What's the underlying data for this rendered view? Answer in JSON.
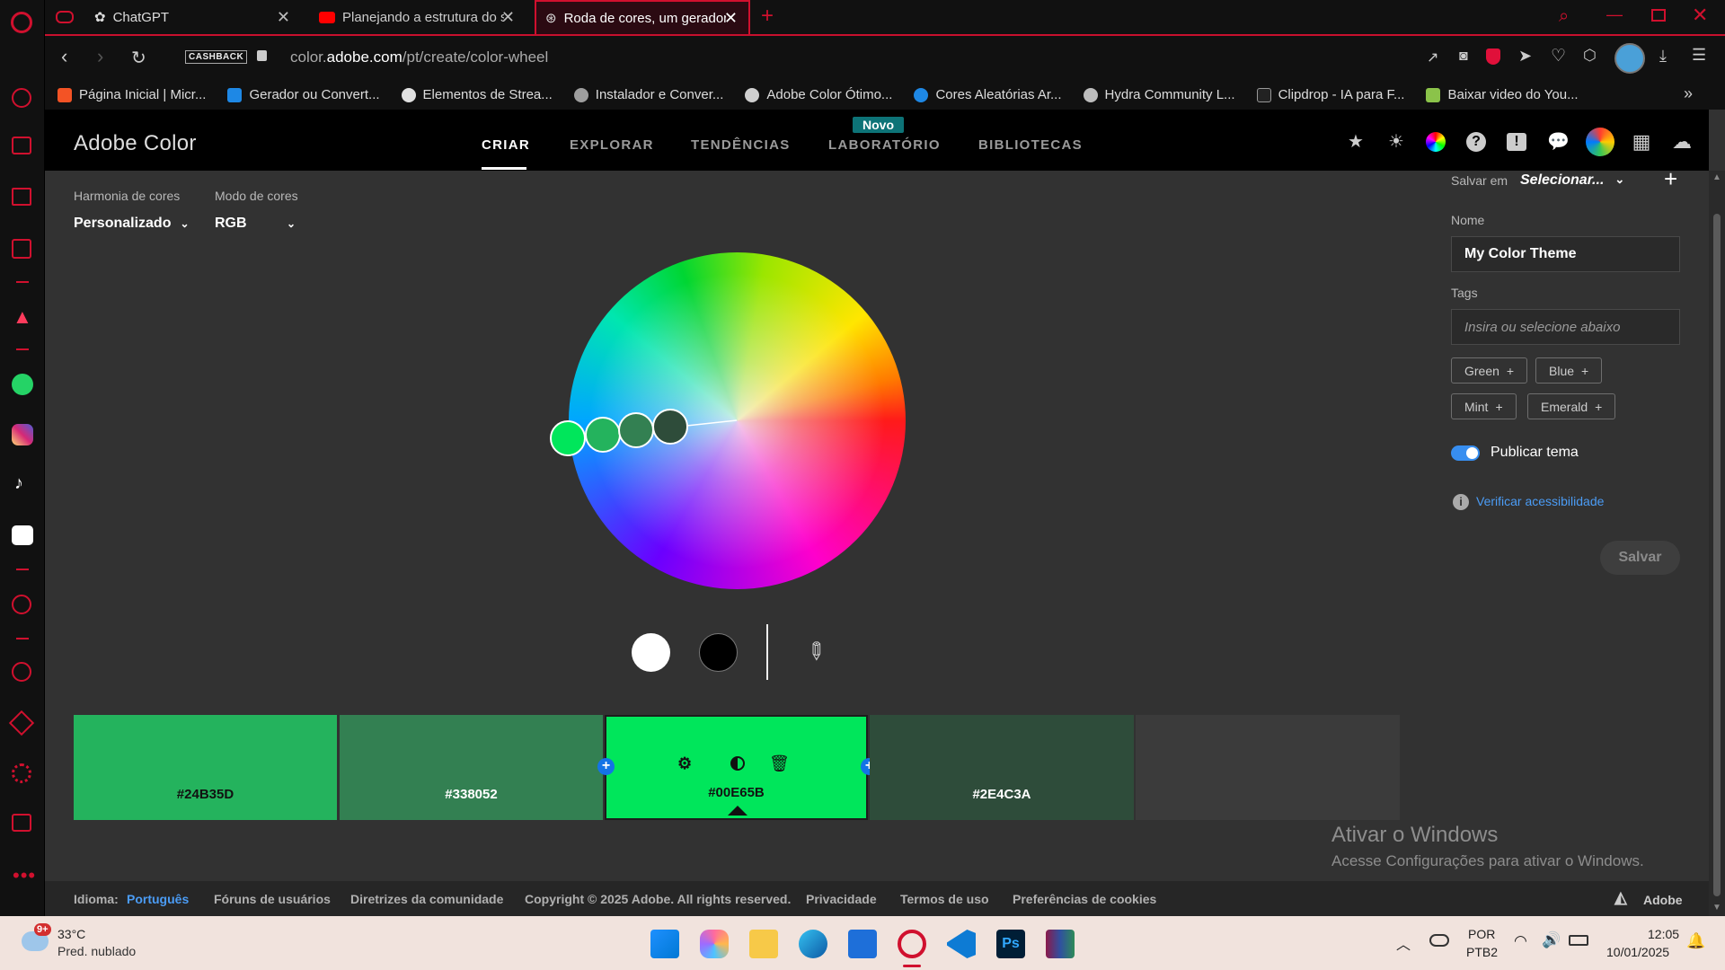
{
  "tabs": [
    {
      "title": "ChatGPT"
    },
    {
      "title": "Planejando a estrutura do s"
    },
    {
      "title": "Roda de cores, um gerador"
    }
  ],
  "address": {
    "url_pre": "color.",
    "url_host": "adobe.com",
    "url_post": "/pt/create/color-wheel",
    "cashback": "CASHBACK"
  },
  "bookmarks": [
    {
      "label": "Página Inicial | Micr...",
      "color": "#f35325"
    },
    {
      "label": "Gerador ou Convert...",
      "color": "#1e88e5"
    },
    {
      "label": "Elementos de Strea...",
      "color": "#e0e0e0"
    },
    {
      "label": "Instalador e Conver...",
      "color": "#9e9e9e"
    },
    {
      "label": "Adobe Color Ótimo...",
      "color": "#cfcfcf"
    },
    {
      "label": "Cores Aleatórias Ar...",
      "color": "#1e88e5"
    },
    {
      "label": "Hydra Community L...",
      "color": "#bdbdbd"
    },
    {
      "label": "Clipdrop - IA para F...",
      "color": "#222222"
    },
    {
      "label": "Baixar video do You...",
      "color": "#8bc34a"
    }
  ],
  "header": {
    "logo": "Adobe Color",
    "nav": [
      {
        "label": "CRIAR"
      },
      {
        "label": "EXPLORAR"
      },
      {
        "label": "TENDÊNCIAS"
      },
      {
        "label": "LABORATÓRIO"
      },
      {
        "label": "BIBLIOTECAS"
      }
    ],
    "badge": "Novo"
  },
  "controls": {
    "harmony_label": "Harmonia de cores",
    "harmony_value": "Personalizado",
    "mode_label": "Modo de cores",
    "mode_value": "RGB"
  },
  "swatches": [
    {
      "hex": "#24B35D",
      "color": "#24b35d"
    },
    {
      "hex": "#338052",
      "color": "#338052"
    },
    {
      "hex": "#00E65B",
      "color": "#00e65b"
    },
    {
      "hex": "#2E4C3A",
      "color": "#2e4c3a"
    }
  ],
  "panel": {
    "save_in_label": "Salvar em",
    "save_in_value": "Selecionar...",
    "name_label": "Nome",
    "name_value": "My Color Theme",
    "tags_label": "Tags",
    "tags_placeholder": "Insira ou selecione abaixo",
    "tags": [
      {
        "label": "Green"
      },
      {
        "label": "Blue"
      },
      {
        "label": "Mint"
      },
      {
        "label": "Emerald"
      }
    ],
    "publish_label": "Publicar tema",
    "publish_on": true,
    "a11y_link": "Verificar acessibilidade",
    "save_button": "Salvar"
  },
  "watermark": {
    "title": "Ativar o Windows",
    "subtitle": "Acesse Configurações para ativar o Windows."
  },
  "footer": {
    "lang_label": "Idioma:",
    "lang_value": "Português",
    "links": [
      {
        "label": "Fóruns de usuários"
      },
      {
        "label": "Diretrizes da comunidade"
      },
      {
        "label": "Copyright © 2025 Adobe. All rights reserved."
      },
      {
        "label": "Privacidade"
      },
      {
        "label": "Termos de uso"
      },
      {
        "label": "Preferências de cookies"
      }
    ],
    "brand": "Adobe"
  },
  "taskbar": {
    "weather_temp": "33°C",
    "weather_desc": "Pred. nublado",
    "weather_badge": "9+",
    "lang_top": "POR",
    "lang_bottom": "PTB2",
    "time": "12:05",
    "date": "10/01/2025"
  }
}
